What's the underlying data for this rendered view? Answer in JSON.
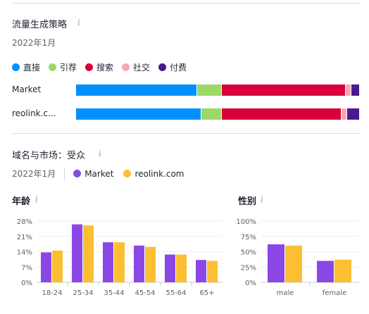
{
  "traffic": {
    "title": "流量生成策略",
    "date": "2022年1月",
    "legend": [
      {
        "label": "直接",
        "color": "#0091ff"
      },
      {
        "label": "引荐",
        "color": "#9cd868"
      },
      {
        "label": "搜索",
        "color": "#d8003a"
      },
      {
        "label": "社交",
        "color": "#f6a9b5"
      },
      {
        "label": "付费",
        "color": "#4a1a8c"
      }
    ]
  },
  "audience": {
    "title": "域名与市场：受众",
    "date": "2022年1月",
    "legend": [
      {
        "label": "Market",
        "color": "#8a47e6"
      },
      {
        "label": "reolink.com",
        "color": "#fcbf32"
      }
    ]
  },
  "chart_data": [
    {
      "type": "bar",
      "orientation": "horizontal-stacked",
      "categories": [
        "Market",
        "reolink.c..."
      ],
      "series": [
        {
          "name": "直接",
          "values": [
            43,
            44.5
          ]
        },
        {
          "name": "引荐",
          "values": [
            8.5,
            7
          ]
        },
        {
          "name": "搜索",
          "values": [
            44,
            42.5
          ]
        },
        {
          "name": "社交",
          "values": [
            1.8,
            1.8
          ]
        },
        {
          "name": "付费",
          "values": [
            2.7,
            4.2
          ]
        }
      ],
      "xlim": [
        0,
        100
      ]
    },
    {
      "type": "bar",
      "title": "年龄",
      "categories": [
        "18-24",
        "25-34",
        "35-44",
        "45-54",
        "55-64",
        "65+"
      ],
      "series": [
        {
          "name": "Market",
          "values": [
            13.7,
            26.5,
            18.3,
            16.8,
            12.7,
            10.2
          ]
        },
        {
          "name": "reolink.com",
          "values": [
            14.5,
            26,
            18.3,
            16.2,
            12.7,
            9.8
          ]
        }
      ],
      "yticks": [
        "0%",
        "7%",
        "14%",
        "21%",
        "28%"
      ],
      "ylim": [
        0,
        28
      ],
      "grid": true
    },
    {
      "type": "bar",
      "title": "性别",
      "categories": [
        "male",
        "female"
      ],
      "series": [
        {
          "name": "Market",
          "values": [
            62,
            35
          ]
        },
        {
          "name": "reolink.com",
          "values": [
            60,
            37
          ]
        }
      ],
      "yticks": [
        "0%",
        "25%",
        "50%",
        "75%",
        "100%"
      ],
      "ylim": [
        0,
        100
      ],
      "grid": true
    }
  ]
}
